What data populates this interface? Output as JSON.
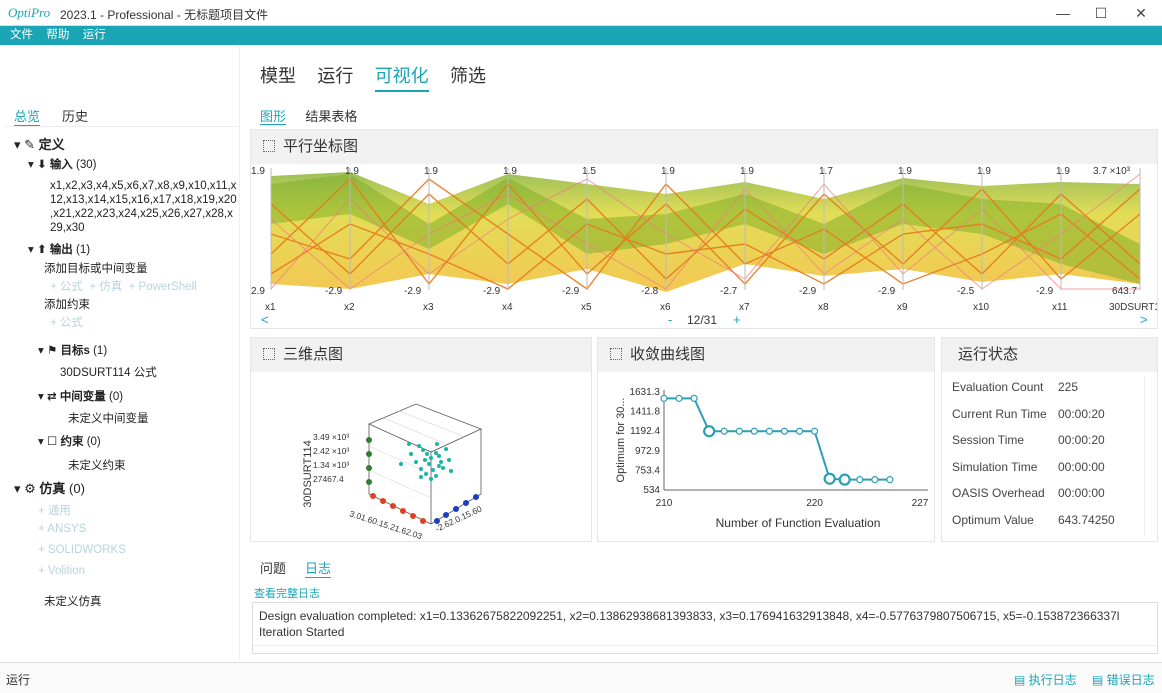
{
  "window": {
    "logo": "OptiPro",
    "title": "2023.1 - Professional - 无标题项目文件",
    "min": "—",
    "max": "☐",
    "close": "✕"
  },
  "menu": [
    "文件",
    "帮助",
    "运行"
  ],
  "left": {
    "tabs": [
      "总览",
      "历史"
    ],
    "definition": "定义",
    "inputs_label": "输入",
    "inputs_count": "(30)",
    "inputs_list": [
      "x1,x2,x3,x4,x5,x6,x7,x8,x9,x10,x11,x",
      "12,x13,x14,x15,x16,x17,x18,x19,x20",
      ",x21,x22,x23,x24,x25,x26,x27,x28,x",
      "29,x30"
    ],
    "outputs_label": "输出",
    "outputs_count": "(1)",
    "add_output": "添加目标或中间变量",
    "output_actions": [
      "公式",
      "仿真",
      "PowerShell"
    ],
    "add_constraint": "添加约束",
    "constraint_action": "公式",
    "targets_label": "目标s",
    "targets_count": "(1)",
    "target_item": "30DSURT114  公式",
    "mid_label": "中间变量",
    "mid_count": "(0)",
    "mid_empty": "未定义中间变量",
    "cons_label": "约束",
    "cons_count": "(0)",
    "cons_empty": "未定义约束",
    "sim_label": "仿真",
    "sim_count": "(0)",
    "sim_items": [
      "通用",
      "ANSYS",
      "SOLIDWORKS",
      "Volition"
    ],
    "sim_empty": "未定义仿真"
  },
  "main_tabs": [
    "模型",
    "运行",
    "可视化",
    "筛选"
  ],
  "sub_tabs": [
    "图形",
    "结果表格"
  ],
  "parallel": {
    "title": "平行坐标图",
    "top_labels": [
      "1.9",
      "1.9",
      "1.9",
      "1.5",
      "1.9",
      "1.9",
      "1.7",
      "1.9",
      "1.9",
      "1.9",
      "3.7 ×10³"
    ],
    "bottom_labels": [
      "-2.9",
      "-2.9",
      "-2.9",
      "-2.9",
      "-2.8",
      "-2.8",
      "-2.7",
      "-2.9",
      "-2.9",
      "-2.5",
      "-2.9",
      "643.7"
    ],
    "axes": [
      "x1",
      "x2",
      "x3",
      "x4",
      "x5",
      "x6",
      "x7",
      "x8",
      "x9",
      "x10",
      "x11",
      "30DSURT1"
    ],
    "left_top": "1.9",
    "left_bottom": "2.9",
    "nav_prev": "<",
    "nav_next": ">",
    "page": "12/31",
    "minus": "-",
    "plus": "+"
  },
  "scatter3d": {
    "title": "三维点图",
    "zlabel": "30DSURT114",
    "zticks": [
      "3.49 ×10³",
      "2.42 ×10³",
      "1.34 ×10³",
      "27467.4"
    ],
    "xticks": "3.01.60.15.21.62.03",
    "yticks": "-2.62.0.15.60"
  },
  "convergence": {
    "title": "收敛曲线图",
    "ylabel": "Optimum for 30...",
    "xlabel": "Number of Function Evaluation",
    "yticks": [
      "1631.3",
      "1411.8",
      "1192.4",
      "972.9",
      "753.4",
      "534"
    ],
    "xticks": [
      "210",
      "220",
      "227"
    ]
  },
  "chart_data": {
    "type": "line",
    "title": "收敛曲线图",
    "xlabel": "Number of Function Evaluation",
    "ylabel": "Optimum for 30...",
    "xlim": [
      210,
      227
    ],
    "ylim": [
      534,
      1631.3
    ],
    "x": [
      210,
      211,
      212,
      213,
      214,
      215,
      216,
      217,
      218,
      219,
      220,
      221,
      222,
      223,
      224,
      225
    ],
    "y": [
      1560,
      1560,
      1560,
      1192,
      1192,
      1192,
      1192,
      1192,
      1192,
      1192,
      1192,
      660,
      650,
      650,
      650,
      650
    ]
  },
  "status": {
    "title": "运行状态",
    "rows": [
      [
        "Evaluation Count",
        "225"
      ],
      [
        "Current Run Time",
        "00:00:20"
      ],
      [
        "Session Time",
        "00:00:20"
      ],
      [
        "Simulation Time",
        "00:00:00"
      ],
      [
        "OASIS Overhead",
        "00:00:00"
      ],
      [
        "Optimum Value",
        "643.74250"
      ]
    ]
  },
  "log": {
    "tabs": [
      "问题",
      "日志"
    ],
    "view_all": "查看完整日志",
    "lines": [
      "Design evaluation completed: x1=0.13362675822092251, x2=0.13862938681393833, x3=0.176941632913848, x4=-0.5776379807506715, x5=-0.153872366337l",
      "Iteration Started"
    ]
  },
  "statusbar": {
    "left": "运行",
    "exec_log": "执行日志",
    "error_log": "错误日志"
  },
  "colors": {
    "accent": "#1aa5b5",
    "orange": "#e8791a",
    "yellow": "#f2c21b",
    "green": "#7aab23"
  }
}
